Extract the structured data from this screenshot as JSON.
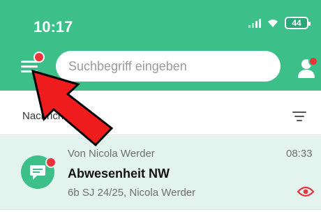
{
  "status_bar": {
    "time": "10:17",
    "battery": "44"
  },
  "search": {
    "placeholder": "Suchbegriff eingeben"
  },
  "sub_header": {
    "title": "Nachrichten"
  },
  "messages": [
    {
      "sender": "Von Nicola Werder",
      "time": "08:33",
      "subject": "Abwesenheit NW",
      "recipients": "6b SJ 24/25, Nicola Werder",
      "unread": true
    }
  ],
  "colors": {
    "brand_green": "#3dbf8a",
    "unread_red": "#e8353b",
    "arrow_red": "#ee1c1c",
    "selected_row": "#e3f3ee"
  },
  "icons": {
    "menu": "hamburger-menu-icon",
    "profile": "profile-icon",
    "filter": "filter-icon",
    "avatar": "chat-bubble-icon",
    "read_status": "eye-icon",
    "pointer": "red-arrow-annotation"
  }
}
